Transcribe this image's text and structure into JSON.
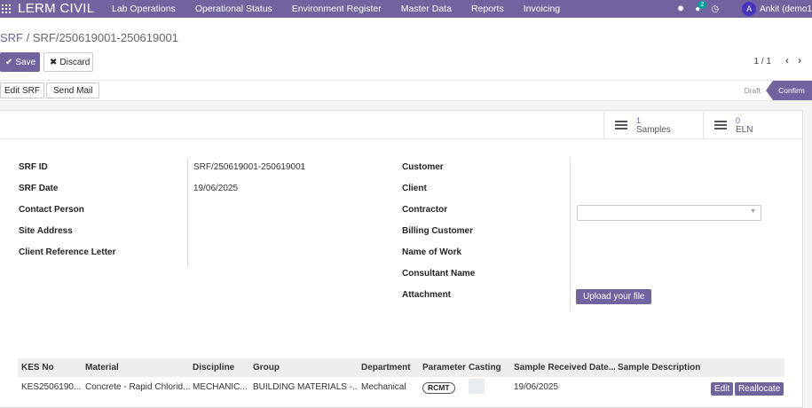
{
  "topbar": {
    "brand": "LERM CIVIL",
    "menu": [
      "Lab Operations",
      "Operational Status",
      "Environment Register",
      "Master Data",
      "Reports",
      "Invoicing"
    ],
    "icons": [
      "apps-grid-icon",
      "bug-icon",
      "chat-icon",
      "clock-icon"
    ],
    "chat_badge": "2",
    "avatar_letter": "A",
    "user": "Ankit (demo1"
  },
  "breadcrumb": {
    "root": "SRF",
    "separator": " / ",
    "current": "SRF/250619001-250619001"
  },
  "actions": {
    "save": "Save",
    "discard": "Discard"
  },
  "pager": {
    "value": "1 / 1"
  },
  "header_buttons": {
    "edit_srf": "Edit SRF",
    "send_mail": "Send Mail"
  },
  "statusbar": {
    "stages": [
      "Draft",
      "Confirm"
    ],
    "active": "Confirm"
  },
  "smart_buttons": [
    {
      "count": "1",
      "label": "Samples"
    },
    {
      "count": "0",
      "label": "ELN"
    }
  ],
  "left_fields": [
    {
      "label": "SRF ID",
      "value": "SRF/250619001-250619001"
    },
    {
      "label": "SRF Date",
      "value": "19/06/2025"
    },
    {
      "label": "Contact Person",
      "value": ""
    },
    {
      "label": "Site Address",
      "value": ""
    },
    {
      "label": "Client Reference Letter",
      "value": ""
    }
  ],
  "right_fields": [
    {
      "label": "Customer"
    },
    {
      "label": "Client"
    },
    {
      "label": "Contractor"
    },
    {
      "label": "Billing Customer"
    },
    {
      "label": "Name of Work"
    },
    {
      "label": "Consultant Name"
    },
    {
      "label": "Attachment"
    }
  ],
  "upload_label": "Upload your file",
  "table": {
    "columns": [
      "KES No",
      "Material",
      "Discipline",
      "Group",
      "Department",
      "Parameter",
      "Casting",
      "Sample Received Date...",
      "Sample Description"
    ],
    "rows": [
      {
        "kes_no": "KES2506190...",
        "material": "Concrete - Rapid Chlorid...",
        "discipline": "MECHANIC...",
        "group": "BUILDING MATERIALS -...",
        "department": "Mechanical",
        "parameter": "RCMT",
        "casting": "",
        "received_date": "19/06/2025",
        "description": "",
        "edit": "Edit",
        "reallocate": "Reallocate"
      }
    ]
  },
  "colors": {
    "primary": "#71639e",
    "badge": "#00a09d",
    "avatar": "#4433bb"
  }
}
